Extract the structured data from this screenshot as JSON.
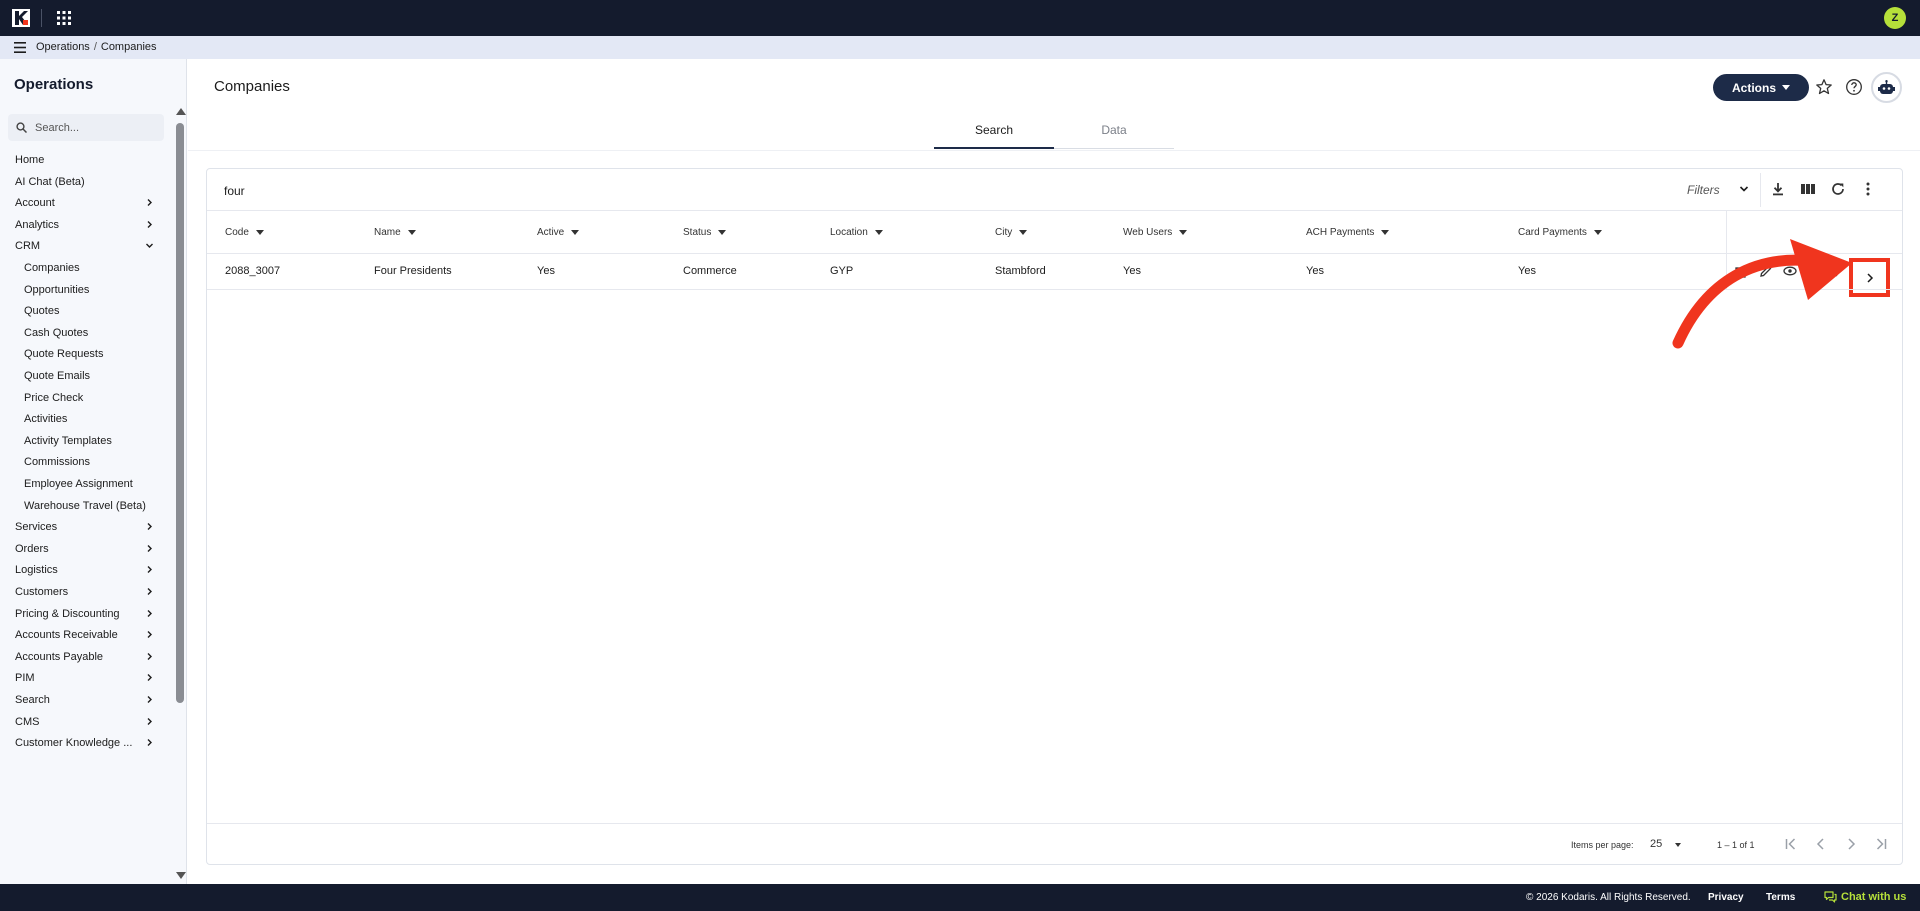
{
  "topbar": {
    "logo_icon": "kodaris-logo",
    "apps_icon": "apps-grid-icon",
    "user_initial": "Z",
    "colors": {
      "bar": "#141b2d",
      "avatar": "#b6e03a"
    }
  },
  "breadcrumb": {
    "items": [
      "Operations",
      "Companies"
    ],
    "separator": "/"
  },
  "sidebar": {
    "title": "Operations",
    "search_placeholder": "Search...",
    "items": [
      {
        "label": "Home",
        "level": 0,
        "chevron": "none"
      },
      {
        "label": "AI Chat (Beta)",
        "level": 0,
        "chevron": "none"
      },
      {
        "label": "Account",
        "level": 0,
        "chevron": "right"
      },
      {
        "label": "Analytics",
        "level": 0,
        "chevron": "right"
      },
      {
        "label": "CRM",
        "level": 0,
        "chevron": "down"
      },
      {
        "label": "Companies",
        "level": 1,
        "chevron": "none"
      },
      {
        "label": "Opportunities",
        "level": 1,
        "chevron": "none"
      },
      {
        "label": "Quotes",
        "level": 1,
        "chevron": "none"
      },
      {
        "label": "Cash Quotes",
        "level": 1,
        "chevron": "none"
      },
      {
        "label": "Quote Requests",
        "level": 1,
        "chevron": "none"
      },
      {
        "label": "Quote Emails",
        "level": 1,
        "chevron": "none"
      },
      {
        "label": "Price Check",
        "level": 1,
        "chevron": "none"
      },
      {
        "label": "Activities",
        "level": 1,
        "chevron": "none"
      },
      {
        "label": "Activity Templates",
        "level": 1,
        "chevron": "none"
      },
      {
        "label": "Commissions",
        "level": 1,
        "chevron": "none"
      },
      {
        "label": "Employee Assignment",
        "level": 1,
        "chevron": "none"
      },
      {
        "label": "Warehouse Travel (Beta)",
        "level": 1,
        "chevron": "none"
      },
      {
        "label": "Services",
        "level": 0,
        "chevron": "right"
      },
      {
        "label": "Orders",
        "level": 0,
        "chevron": "right"
      },
      {
        "label": "Logistics",
        "level": 0,
        "chevron": "right"
      },
      {
        "label": "Customers",
        "level": 0,
        "chevron": "right"
      },
      {
        "label": "Pricing & Discounting",
        "level": 0,
        "chevron": "right"
      },
      {
        "label": "Accounts Receivable",
        "level": 0,
        "chevron": "right"
      },
      {
        "label": "Accounts Payable",
        "level": 0,
        "chevron": "right"
      },
      {
        "label": "PIM",
        "level": 0,
        "chevron": "right"
      },
      {
        "label": "Search",
        "level": 0,
        "chevron": "right"
      },
      {
        "label": "CMS",
        "level": 0,
        "chevron": "right"
      },
      {
        "label": "Customer Knowledge ...",
        "level": 0,
        "chevron": "right"
      }
    ]
  },
  "header": {
    "title": "Companies",
    "actions_label": "Actions",
    "icons": [
      "star-icon",
      "help-icon",
      "ai-bot-icon"
    ],
    "accent": "#1d2b48"
  },
  "tabs": [
    {
      "label": "Search",
      "active": true
    },
    {
      "label": "Data",
      "active": false
    }
  ],
  "grid": {
    "search_value": "four",
    "filters_label": "Filters",
    "toolbar_icons": [
      "download-icon",
      "columns-icon",
      "refresh-icon",
      "more-vert-icon"
    ],
    "columns": [
      "Code",
      "Name",
      "Active",
      "Status",
      "Location",
      "City",
      "Web Users",
      "ACH Payments",
      "Card Payments"
    ],
    "rows": [
      {
        "cells": [
          "2088_3007",
          "Four Presidents",
          "Yes",
          "Commerce",
          "GYP",
          "Stambford",
          "Yes",
          "Yes",
          "Yes"
        ]
      }
    ],
    "row_action_icons": [
      "add-note-icon",
      "edit-icon",
      "view-icon",
      "notes-icon",
      "more-icon",
      "chevron-right-icon"
    ],
    "annotation_color": "#f0351e"
  },
  "pagination": {
    "items_per_page_label": "Items per page:",
    "page_size": "25",
    "range": "1 – 1 of 1",
    "icons": [
      "first-page-icon",
      "prev-page-icon",
      "next-page-icon",
      "last-page-icon"
    ]
  },
  "footer": {
    "copyright": "© 2026 Kodaris. All Rights Reserved.",
    "privacy": "Privacy",
    "terms": "Terms",
    "chat": "Chat with us"
  }
}
